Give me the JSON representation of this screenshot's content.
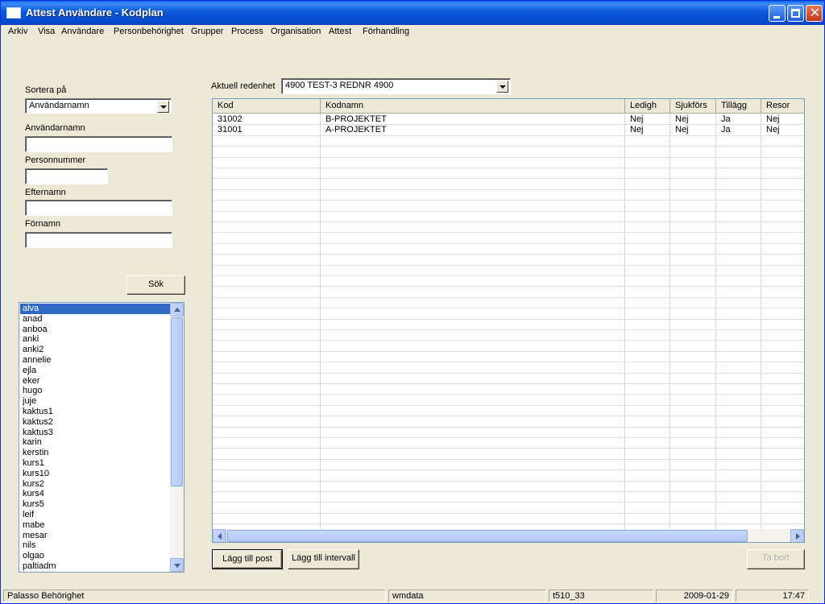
{
  "window": {
    "title": "Attest Användare - Kodplan"
  },
  "menu": [
    "Arkiv",
    "Visa",
    "Användare",
    "Personbehörighet",
    "Grupper",
    "Process",
    "Organisation",
    "Attest",
    "Förhandling"
  ],
  "search_panel": {
    "sort_label": "Sortera på",
    "sort_value": "Användarnamn",
    "username_label": "Användarnamn",
    "username_value": "",
    "personnummer_label": "Personnummer",
    "personnummer_value": "",
    "efternamn_label": "Efternamn",
    "efternamn_value": "",
    "fornamn_label": "Förnamn",
    "fornamn_value": "",
    "search_button": "Sök"
  },
  "user_list": {
    "selected": "alva",
    "items": [
      "alva",
      "anad",
      "anboa",
      "anki",
      "anki2",
      "annelie",
      "ejla",
      "eker",
      "hugo",
      "juje",
      "kaktus1",
      "kaktus2",
      "kaktus3",
      "karin",
      "kerstin",
      "kurs1",
      "kurs10",
      "kurs2",
      "kurs4",
      "kurs5",
      "leif",
      "mabe",
      "mesar",
      "nils",
      "olgao",
      "paltiadm"
    ]
  },
  "unit": {
    "label": "Aktuell redenhet",
    "value": "4900 TEST-3  REDNR 4900"
  },
  "grid": {
    "columns": [
      "Kod",
      "Kodnamn",
      "Ledigh",
      "Sjukförs",
      "Tillägg",
      "Resor"
    ],
    "rows": [
      [
        "31002",
        "B-PROJEKTET",
        "Nej",
        "Nej",
        "Ja",
        "Nej"
      ],
      [
        "31001",
        "A-PROJEKTET",
        "Nej",
        "Nej",
        "Ja",
        "Nej"
      ]
    ]
  },
  "buttons": {
    "add_post": "Lägg till post",
    "add_interval": "Lägg till intervall",
    "remove": "Ta bort"
  },
  "statusbar": {
    "app": "Palasso Behörighet",
    "server": "wmdata",
    "db": "t510_33",
    "date": "2009-01-29",
    "time": "17:47"
  }
}
